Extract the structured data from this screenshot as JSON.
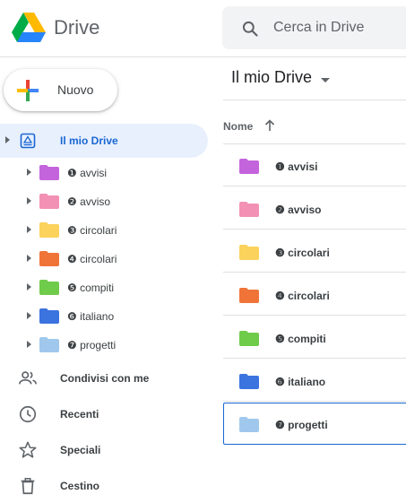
{
  "header": {
    "app_name": "Drive",
    "search_placeholder": "Cerca in Drive"
  },
  "sidebar": {
    "new_button_label": "Nuovo",
    "my_drive_label": "Il mio Drive",
    "folders": [
      {
        "label": "❶ avvisi",
        "color": "#c464dc"
      },
      {
        "label": "❷ avviso",
        "color": "#f291b4"
      },
      {
        "label": "❸ circolari",
        "color": "#fbd25b"
      },
      {
        "label": "❹ circolari",
        "color": "#f07438"
      },
      {
        "label": "❺ compiti",
        "color": "#6fcb4a"
      },
      {
        "label": "❻ italiano",
        "color": "#3b73df"
      },
      {
        "label": "❼ progetti",
        "color": "#9fc8ec"
      }
    ],
    "items": [
      {
        "label": "Condivisi con me",
        "icon": "people-icon"
      },
      {
        "label": "Recenti",
        "icon": "clock-icon"
      },
      {
        "label": "Speciali",
        "icon": "star-icon"
      },
      {
        "label": "Cestino",
        "icon": "trash-icon"
      }
    ]
  },
  "main": {
    "title": "Il mio Drive",
    "column_name": "Nome",
    "sort": "ascending",
    "files": [
      {
        "label": "❶ avvisi",
        "color": "#c464dc"
      },
      {
        "label": "❷ avviso",
        "color": "#f291b4"
      },
      {
        "label": "❸ circolari",
        "color": "#fbd25b"
      },
      {
        "label": "❹ circolari",
        "color": "#f07438"
      },
      {
        "label": "❺ compiti",
        "color": "#6fcb4a"
      },
      {
        "label": "❻ italiano",
        "color": "#3b73df"
      },
      {
        "label": "❼ progetti",
        "color": "#9fc8ec"
      }
    ],
    "selected_index": 6
  }
}
